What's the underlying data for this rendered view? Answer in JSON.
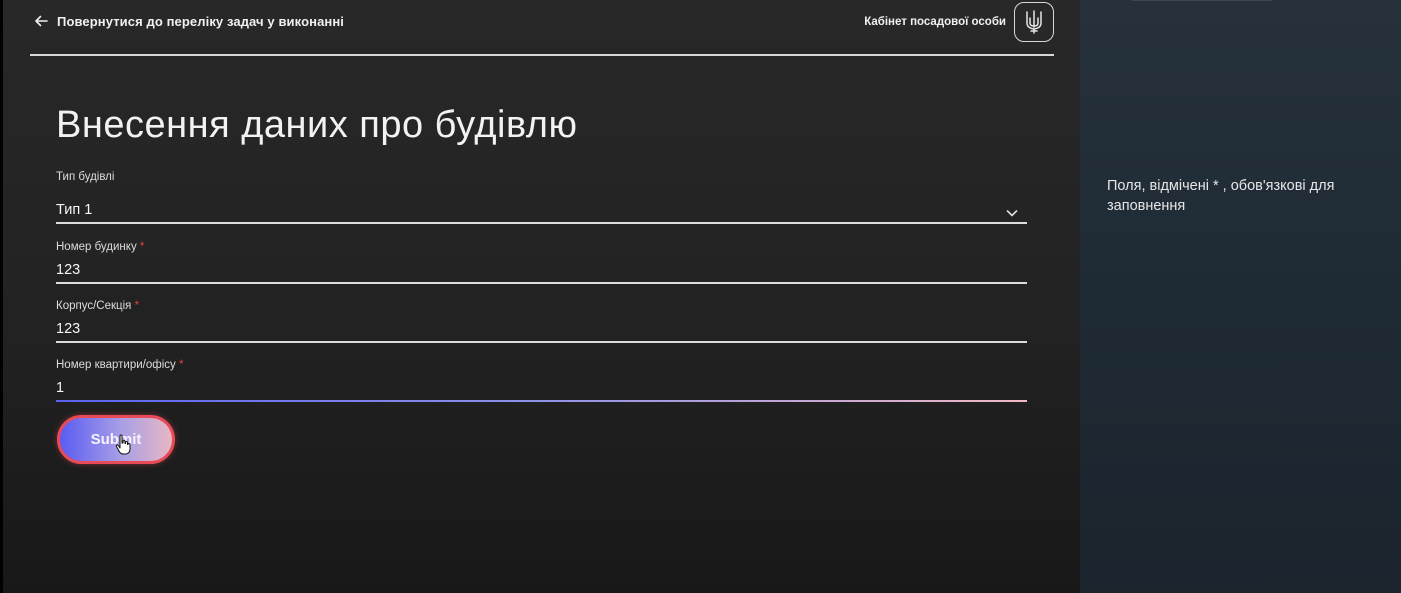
{
  "header": {
    "back_label": "Повернутися до переліку задач у виконанні",
    "cabinet_label": "Кабінет посадової особи",
    "emblem_icon": "trident-icon"
  },
  "page": {
    "title": "Внесення даних про будівлю"
  },
  "form": {
    "building_type": {
      "label": "Тип будівлі",
      "value": "Тип 1"
    },
    "house_number": {
      "label": "Номер будинку",
      "required_mark": "*",
      "value": "123"
    },
    "block_section": {
      "label": "Корпус/Секція",
      "required_mark": "*",
      "value": "123"
    },
    "apartment_office": {
      "label": "Номер квартири/офісу",
      "required_mark": "*",
      "value": "1"
    },
    "submit_label": "Submit"
  },
  "side": {
    "hint": "Поля, відмічені * , обов'язкові для заповнення"
  },
  "colors": {
    "accent_blue": "#5a5cf3",
    "accent_pink": "#e8b7c3",
    "required_red": "#e0453a",
    "focus_border": "#e84a57"
  }
}
